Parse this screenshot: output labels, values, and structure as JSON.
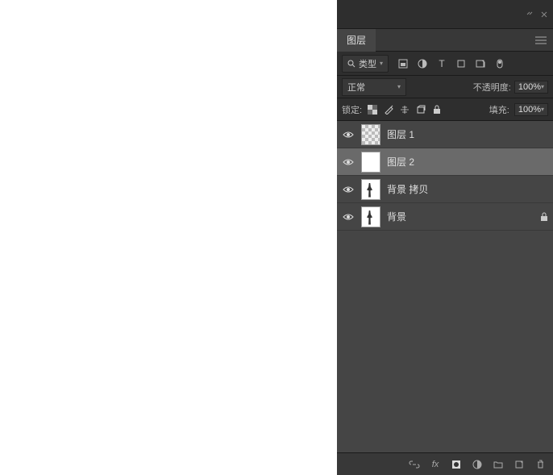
{
  "panel": {
    "tab_label": "图层",
    "filter": {
      "search_icon": "search",
      "type_label": "类型"
    },
    "blend": {
      "mode": "正常",
      "opacity_label": "不透明度:",
      "opacity_value": "100%"
    },
    "lock": {
      "label": "锁定:",
      "fill_label": "填充:",
      "fill_value": "100%"
    },
    "layers": [
      {
        "name": "图层 1",
        "thumb": "checker",
        "selected": false,
        "locked": false
      },
      {
        "name": "图层 2",
        "thumb": "white",
        "selected": true,
        "locked": false
      },
      {
        "name": "背景 拷贝",
        "thumb": "figure",
        "selected": false,
        "locked": false
      },
      {
        "name": "背景",
        "thumb": "figure",
        "selected": false,
        "locked": true
      }
    ]
  }
}
